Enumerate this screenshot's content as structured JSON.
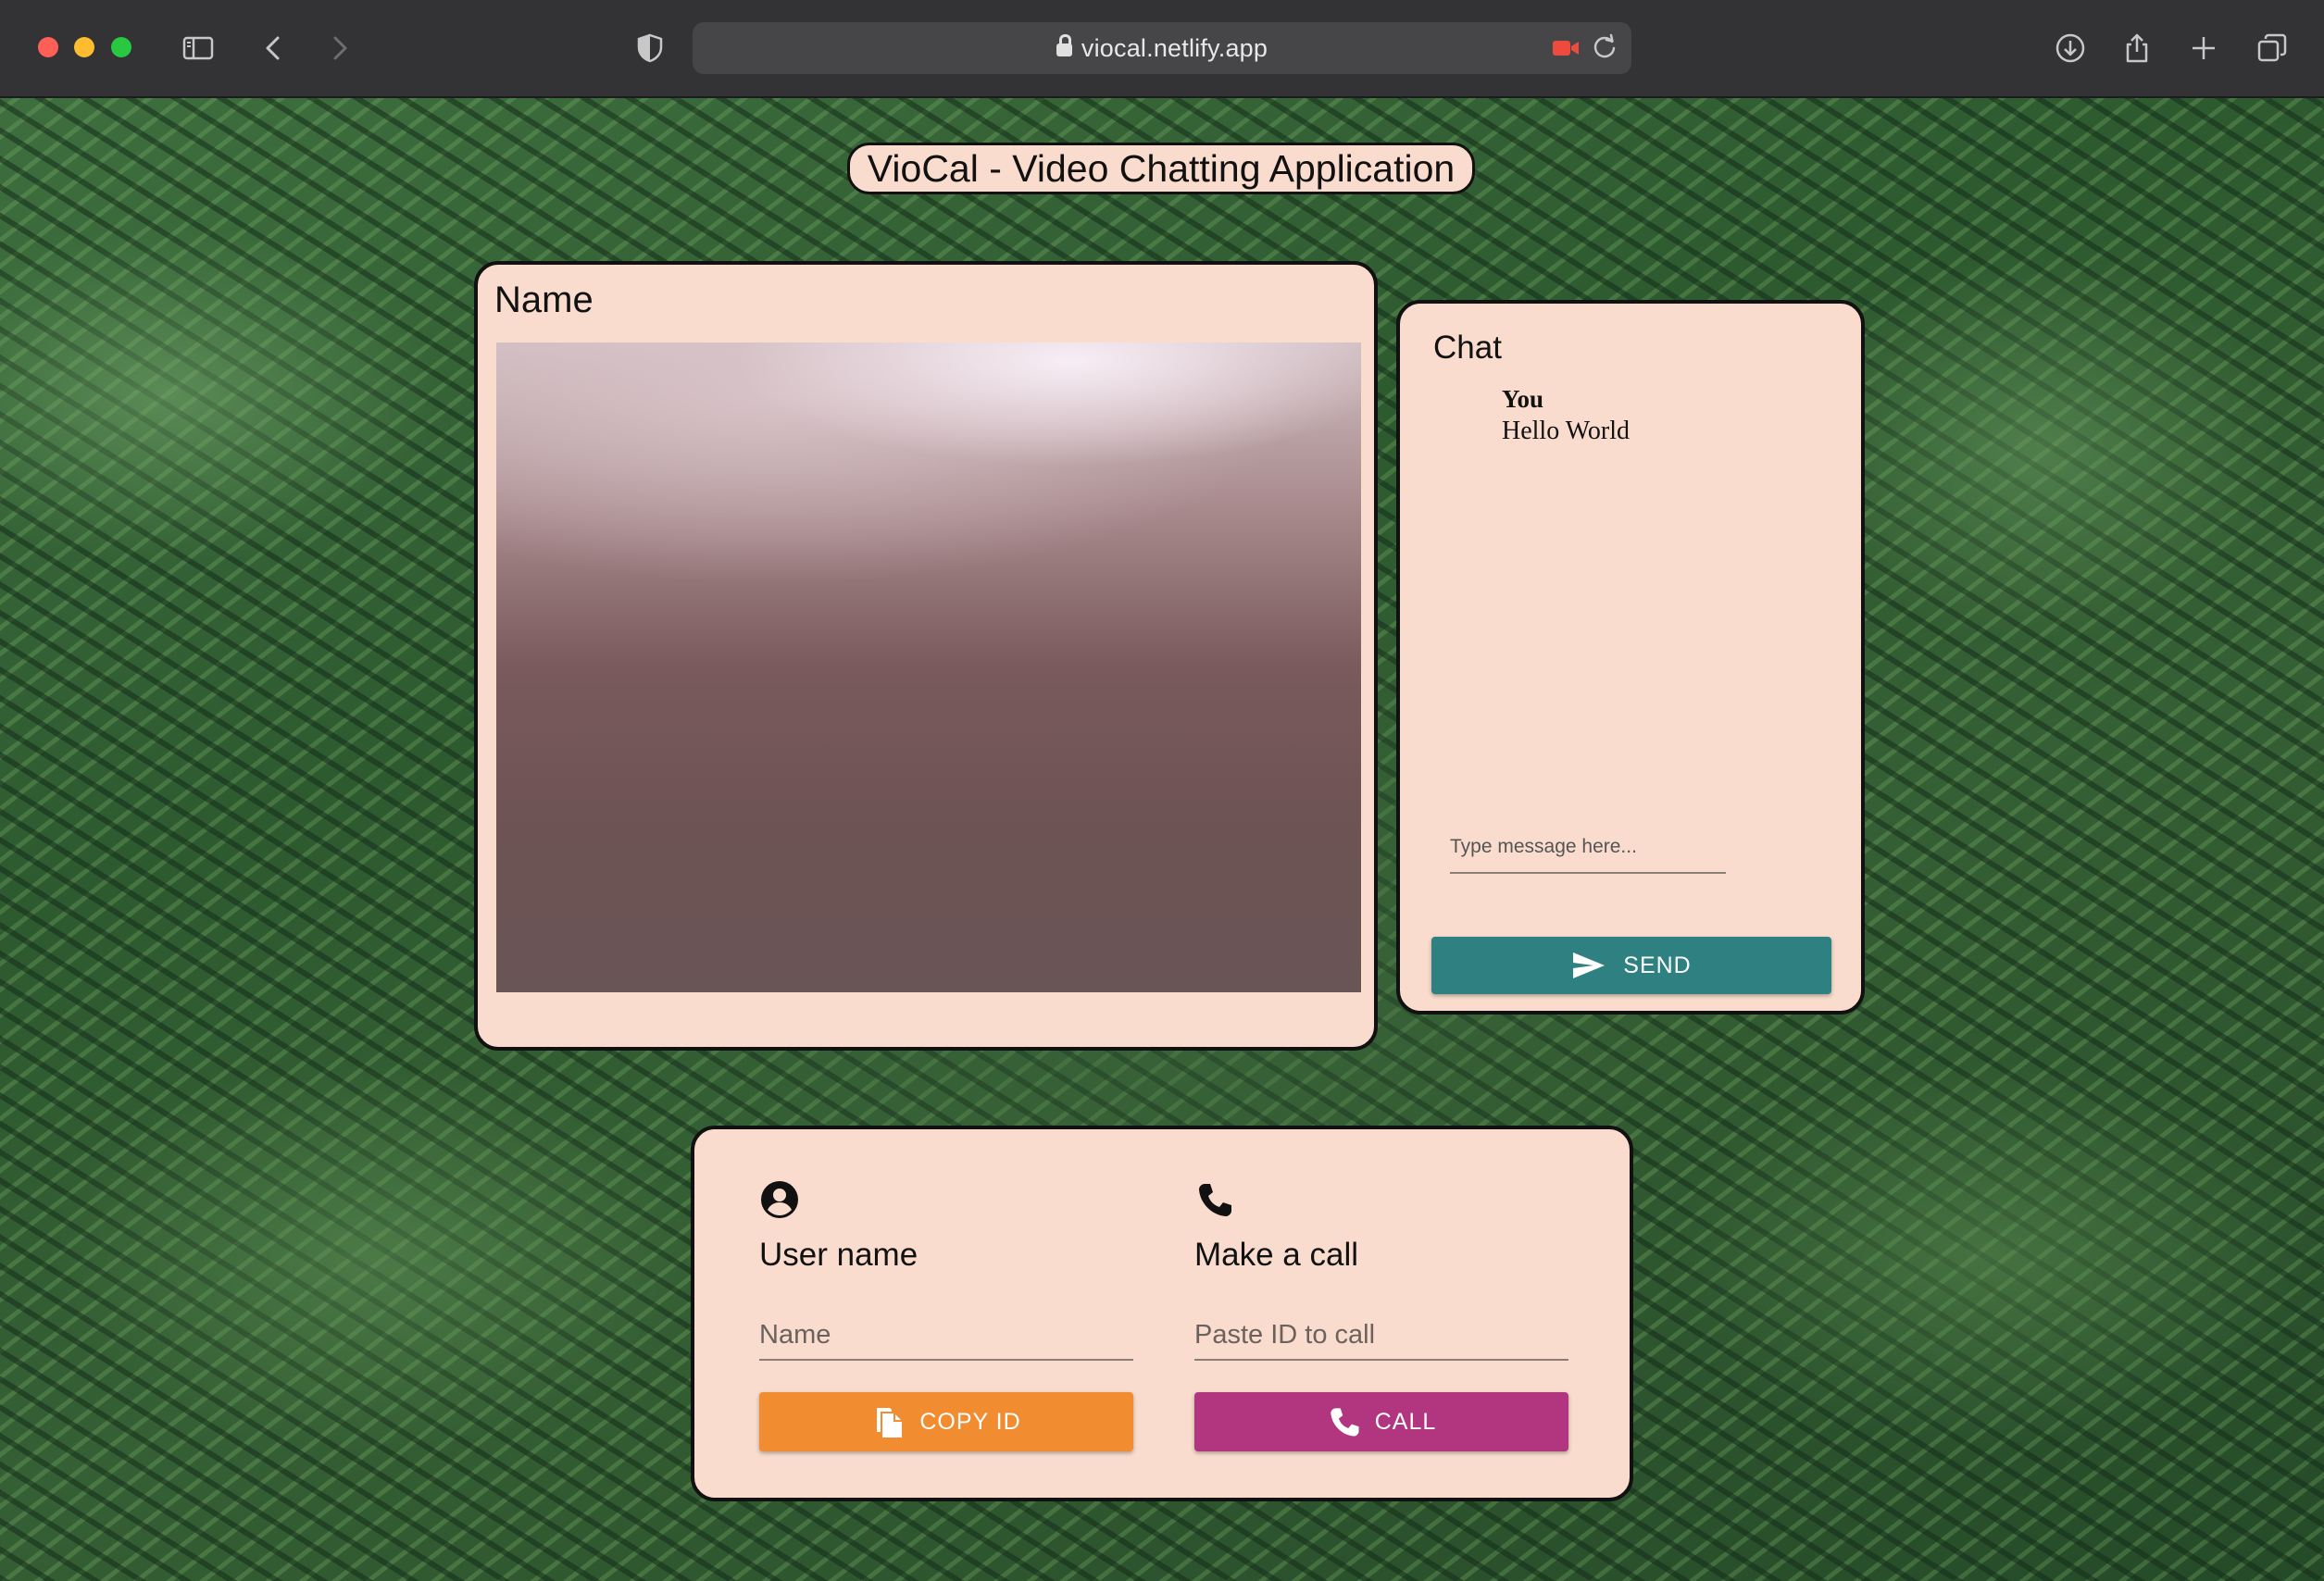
{
  "browser": {
    "url": "viocal.netlify.app"
  },
  "app": {
    "title": "VioCal - Video Chatting Application"
  },
  "video": {
    "name_label": "Name"
  },
  "chat": {
    "title": "Chat",
    "messages": [
      {
        "sender": "You",
        "text": "Hello World"
      }
    ],
    "input_placeholder": "Type message here...",
    "send_label": "SEND",
    "send_color": "#2f8080"
  },
  "controls": {
    "user": {
      "heading": "User name",
      "input_placeholder": "Name",
      "button_label": "COPY ID",
      "button_color": "#f28c30"
    },
    "call": {
      "heading": "Make a call",
      "input_placeholder": "Paste ID to call",
      "button_label": "CALL",
      "button_color": "#b1367f"
    }
  },
  "colors": {
    "card_background": "#f9dccd"
  }
}
